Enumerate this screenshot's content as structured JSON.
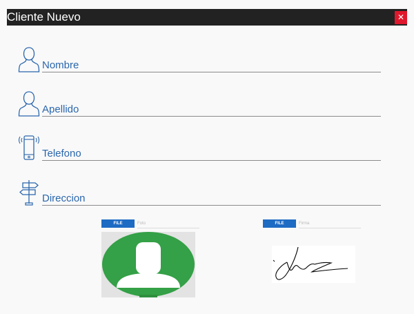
{
  "dialog": {
    "title": "Cliente Nuevo",
    "close_label": "✕"
  },
  "fields": {
    "nombre": {
      "label": "Nombre",
      "icon": "user-icon",
      "value": ""
    },
    "apellido": {
      "label": "Apellido",
      "icon": "user-icon",
      "value": ""
    },
    "telefono": {
      "label": "Telefono",
      "icon": "phone-icon",
      "value": ""
    },
    "direccion": {
      "label": "Direccion",
      "icon": "signpost-icon",
      "value": ""
    }
  },
  "photo_upload": {
    "button_label": "FILE",
    "placeholder": "Foto",
    "preview": "avatar-placeholder"
  },
  "signature_upload": {
    "button_label": "FILE",
    "placeholder": "Firma",
    "preview": "signature-image"
  },
  "colors": {
    "titlebar": "#222222",
    "close": "#e0182d",
    "accent": "#2a66ad",
    "file_button": "#1e6bc4",
    "avatar_green": "#34a047"
  }
}
